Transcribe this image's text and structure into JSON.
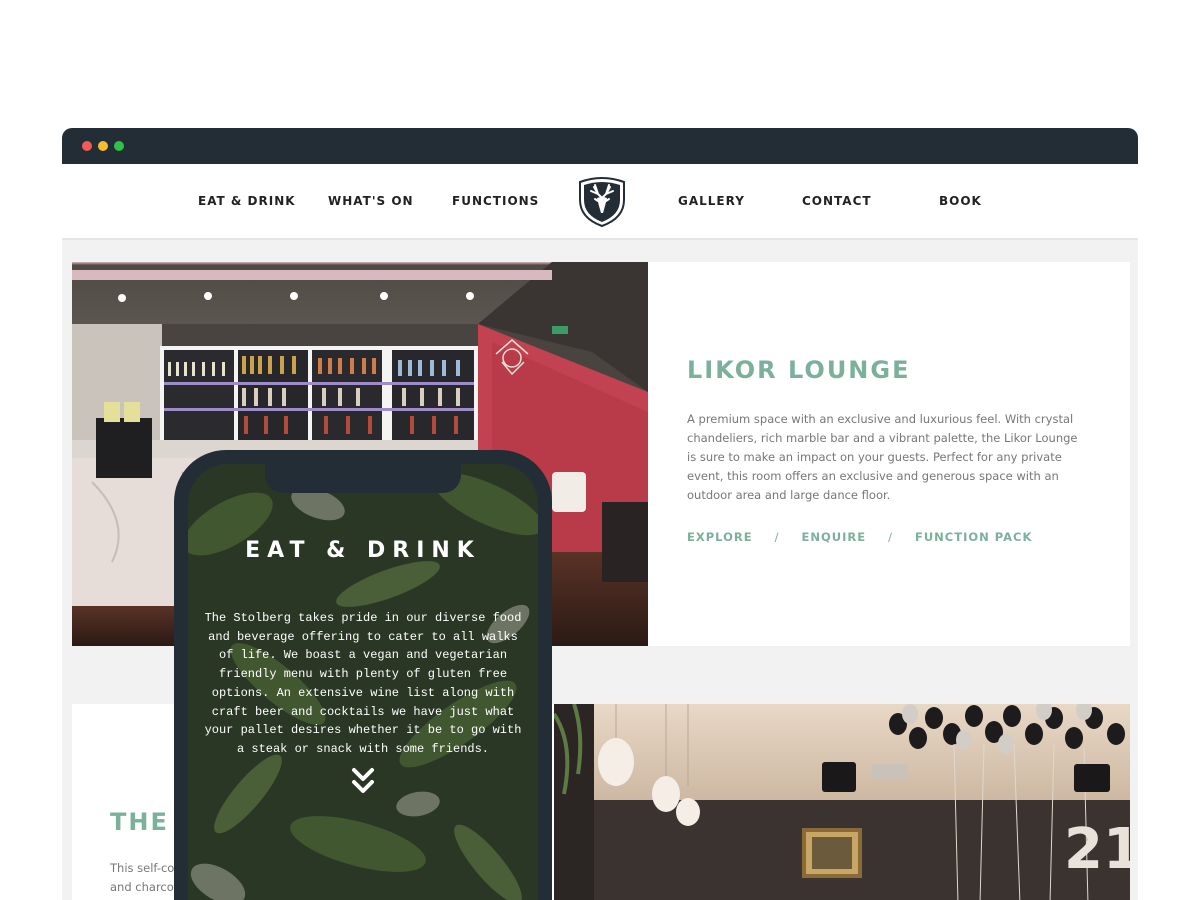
{
  "window": {
    "controls": [
      "close",
      "minimize",
      "maximize"
    ]
  },
  "nav": {
    "items": [
      {
        "label": "EAT & DRINK"
      },
      {
        "label": "WHAT'S ON"
      },
      {
        "label": "FUNCTIONS"
      },
      {
        "label": "GALLERY"
      },
      {
        "label": "CONTACT"
      },
      {
        "label": "BOOK"
      }
    ],
    "logo_icon": "stag-shield-icon"
  },
  "feature": {
    "title": "LIKOR LOUNGE",
    "description": "A premium space with an exclusive and luxurious feel. With crystal chandeliers, rich marble bar and a vibrant palette, the Likor Lounge is sure to make an impact on your guests. Perfect for any private event, this room offers an exclusive and generous space with an outdoor area and large dance floor.",
    "links": [
      "EXPLORE",
      "ENQUIRE",
      "FUNCTION PACK"
    ],
    "separator": "/"
  },
  "second_feature": {
    "title": "THE",
    "description_line1": "This self-co",
    "description_line2": "and charco"
  },
  "phone": {
    "title": "EAT & DRINK",
    "body": "The Stolberg takes pride in our diverse food and beverage offering to cater to all walks of life. We boast a vegan and vegetarian friendly menu with plenty of gluten free options. An extensive wine list along with craft beer and cocktails we have just what your pallet desires whether it be to go with a steak or snack with some friends.",
    "scroll_icon": "double-chevron-down-icon"
  },
  "colors": {
    "accent": "#7bb09b",
    "dark": "#232d36",
    "nav_text": "#222222",
    "body_text": "#777777"
  }
}
